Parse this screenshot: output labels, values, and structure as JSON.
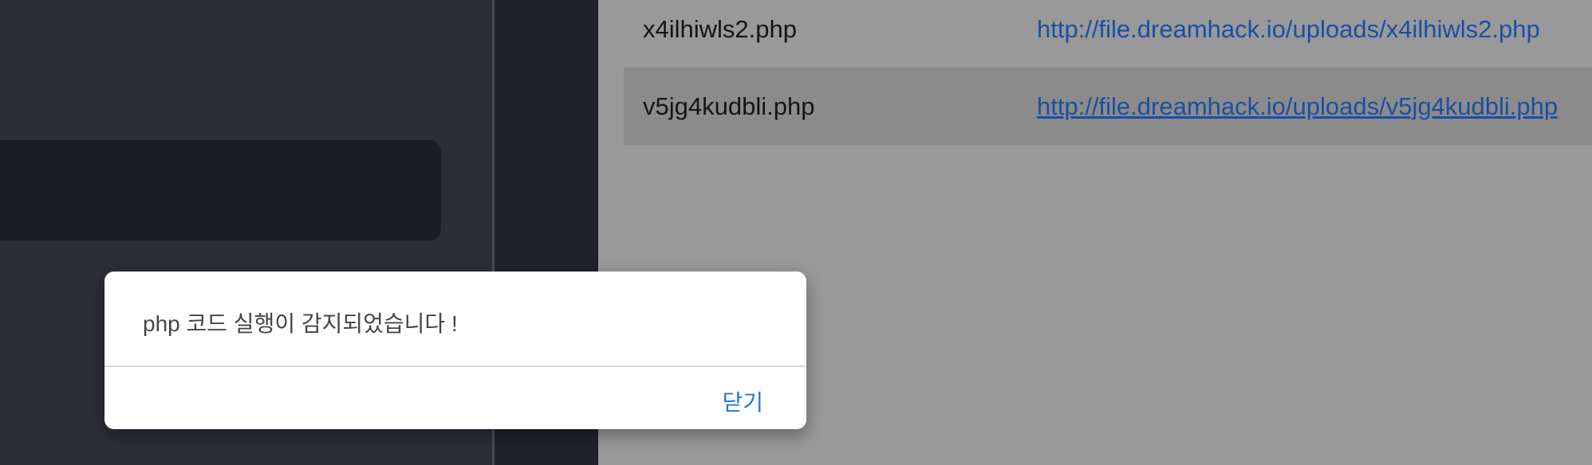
{
  "files": [
    {
      "name": "x4ilhiwls2.php",
      "url": "http://file.dreamhack.io/uploads/x4ilhiwls2.php"
    },
    {
      "name": "v5jg4kudbli.php",
      "url": "http://file.dreamhack.io/uploads/v5jg4kudbli.php"
    }
  ],
  "dialog": {
    "message": "php 코드 실행이 감지되었습니다 !",
    "close_label": "닫기"
  },
  "colors": {
    "link": "#1a4fa5",
    "dialog_button": "#2778d4",
    "overlay": "#999999"
  }
}
